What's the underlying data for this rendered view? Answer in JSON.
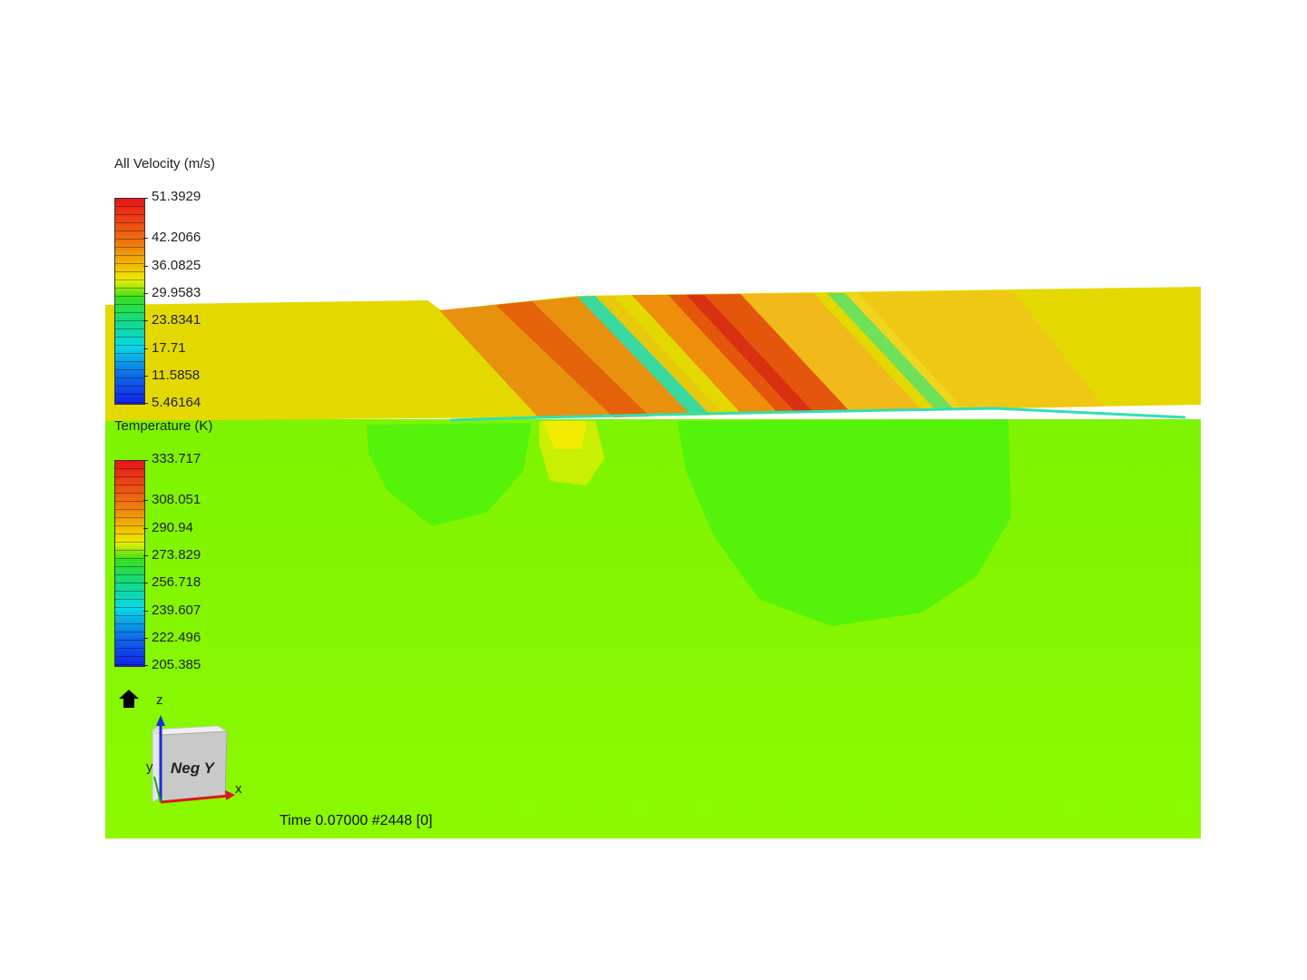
{
  "legends": [
    {
      "title": "All Velocity (m/s)",
      "ticks": [
        "51.3929",
        "42.2066",
        "36.0825",
        "29.9583",
        "23.8341",
        "17.71",
        "11.5858",
        "5.46164"
      ]
    },
    {
      "title": "Temperature (K)",
      "ticks": [
        "333.717",
        "308.051",
        "290.94",
        "273.829",
        "256.718",
        "239.607",
        "222.496",
        "205.385"
      ]
    }
  ],
  "triad": {
    "face_label": "Neg Y",
    "axis_x": "x",
    "axis_y": "y",
    "axis_z": "z"
  },
  "status": {
    "time_text": "Time 0.07000  #2448 [0]"
  },
  "colors": {
    "ground": "#8bf800",
    "flow": "#e3d900",
    "cold_zone": "#55f20a"
  }
}
